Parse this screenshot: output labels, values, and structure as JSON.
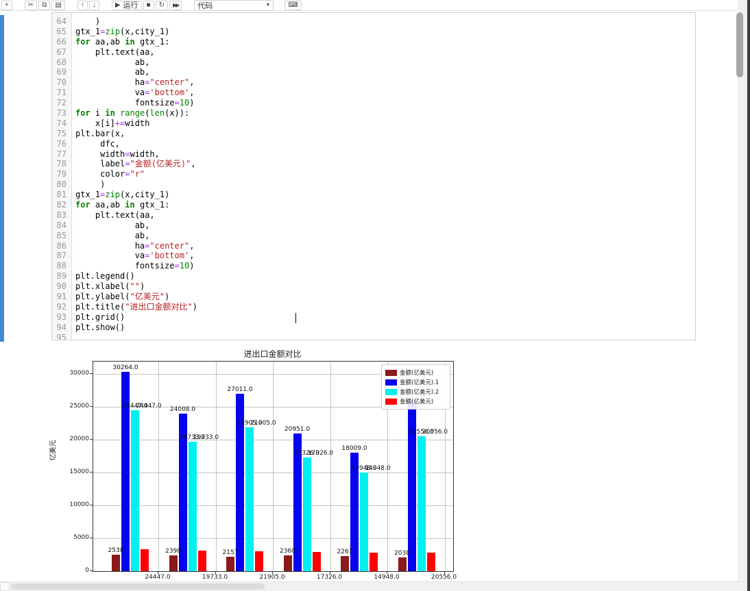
{
  "toolbar": {
    "groups": [
      [
        {
          "name": "insert-cell-below",
          "icon": "plus-icon",
          "glyph": "+"
        }
      ],
      [
        {
          "name": "cut-cell",
          "icon": "scissors-icon",
          "glyph": "✂"
        },
        {
          "name": "copy-cell",
          "icon": "copy-icon",
          "glyph": "⧉"
        },
        {
          "name": "paste-cell",
          "icon": "paste-icon",
          "glyph": "▤"
        }
      ],
      [
        {
          "name": "move-cell-up",
          "icon": "arrow-up-icon",
          "glyph": "↑"
        },
        {
          "name": "move-cell-down",
          "icon": "arrow-down-icon",
          "glyph": "↓"
        }
      ],
      [
        {
          "name": "run-cell",
          "icon": "play-icon",
          "glyph": "▶",
          "label": "运行"
        },
        {
          "name": "interrupt-kernel",
          "icon": "stop-icon",
          "glyph": "■"
        },
        {
          "name": "restart-kernel",
          "icon": "restart-icon",
          "glyph": "↻"
        },
        {
          "name": "restart-run-all",
          "icon": "fast-forward-icon",
          "glyph": "▶▶"
        }
      ]
    ],
    "cell_type": "代码",
    "dropdown_arrow": "▼",
    "keyboard_glyph": "⌨"
  },
  "code_cell": {
    "lines": [
      {
        "n": 64,
        "t": [
          [
            "pl",
            "    )"
          ]
        ]
      },
      {
        "n": 65,
        "t": [
          [
            "pl",
            "gtx_1"
          ],
          [
            "op",
            "="
          ],
          [
            "bi",
            "zip"
          ],
          [
            "pl",
            "(x,city_1)"
          ]
        ]
      },
      {
        "n": 66,
        "t": [
          [
            "kw",
            "for"
          ],
          [
            "pl",
            " aa,ab "
          ],
          [
            "kw",
            "in"
          ],
          [
            "pl",
            " gtx_1:"
          ]
        ]
      },
      {
        "n": 67,
        "t": [
          [
            "pl",
            "    plt.text(aa,"
          ]
        ]
      },
      {
        "n": 68,
        "t": [
          [
            "pl",
            "            ab,"
          ]
        ]
      },
      {
        "n": 69,
        "t": [
          [
            "pl",
            "            ab,"
          ]
        ]
      },
      {
        "n": 70,
        "t": [
          [
            "pl",
            "            ha"
          ],
          [
            "op",
            "="
          ],
          [
            "st",
            "\"center\""
          ],
          [
            "pl",
            ","
          ]
        ]
      },
      {
        "n": 71,
        "t": [
          [
            "pl",
            "            va"
          ],
          [
            "op",
            "="
          ],
          [
            "st",
            "'bottom'"
          ],
          [
            "pl",
            ","
          ]
        ]
      },
      {
        "n": 72,
        "t": [
          [
            "pl",
            "            fontsize"
          ],
          [
            "op",
            "="
          ],
          [
            "nu",
            "10"
          ],
          [
            "pl",
            ")"
          ]
        ]
      },
      {
        "n": 73,
        "t": [
          [
            "kw",
            "for"
          ],
          [
            "pl",
            " i "
          ],
          [
            "kw",
            "in"
          ],
          [
            "pl",
            " "
          ],
          [
            "bi",
            "range"
          ],
          [
            "pl",
            "("
          ],
          [
            "bi",
            "len"
          ],
          [
            "pl",
            "(x)):"
          ]
        ]
      },
      {
        "n": 74,
        "t": [
          [
            "pl",
            "    x[i]"
          ],
          [
            "op",
            "+="
          ],
          [
            "pl",
            "width"
          ]
        ]
      },
      {
        "n": 75,
        "t": [
          [
            "pl",
            "plt.bar(x,"
          ]
        ]
      },
      {
        "n": 76,
        "t": [
          [
            "pl",
            "     dfc,"
          ]
        ]
      },
      {
        "n": 77,
        "t": [
          [
            "pl",
            "     width"
          ],
          [
            "op",
            "="
          ],
          [
            "pl",
            "width,"
          ]
        ]
      },
      {
        "n": 78,
        "t": [
          [
            "pl",
            "     label"
          ],
          [
            "op",
            "="
          ],
          [
            "st",
            "\"金额(亿美元)\""
          ],
          [
            "pl",
            ","
          ]
        ]
      },
      {
        "n": 79,
        "t": [
          [
            "pl",
            "     color"
          ],
          [
            "op",
            "="
          ],
          [
            "st",
            "\"r\""
          ]
        ]
      },
      {
        "n": 80,
        "t": [
          [
            "pl",
            "     )"
          ]
        ]
      },
      {
        "n": 81,
        "t": [
          [
            "pl",
            "gtx_1"
          ],
          [
            "op",
            "="
          ],
          [
            "bi",
            "zip"
          ],
          [
            "pl",
            "(x,city_1)"
          ]
        ]
      },
      {
        "n": 82,
        "t": [
          [
            "kw",
            "for"
          ],
          [
            "pl",
            " aa,ab "
          ],
          [
            "kw",
            "in"
          ],
          [
            "pl",
            " gtx_1:"
          ]
        ]
      },
      {
        "n": 83,
        "t": [
          [
            "pl",
            "    plt.text(aa,"
          ]
        ]
      },
      {
        "n": 84,
        "t": [
          [
            "pl",
            "            ab,"
          ]
        ]
      },
      {
        "n": 85,
        "t": [
          [
            "pl",
            "            ab,"
          ]
        ]
      },
      {
        "n": 86,
        "t": [
          [
            "pl",
            "            ha"
          ],
          [
            "op",
            "="
          ],
          [
            "st",
            "\"center\""
          ],
          [
            "pl",
            ","
          ]
        ]
      },
      {
        "n": 87,
        "t": [
          [
            "pl",
            "            va"
          ],
          [
            "op",
            "="
          ],
          [
            "st",
            "'bottom'"
          ],
          [
            "pl",
            ","
          ]
        ]
      },
      {
        "n": 88,
        "t": [
          [
            "pl",
            "            fontsize"
          ],
          [
            "op",
            "="
          ],
          [
            "nu",
            "10"
          ],
          [
            "pl",
            ")"
          ]
        ]
      },
      {
        "n": 89,
        "t": [
          [
            "pl",
            "plt.legend()"
          ]
        ]
      },
      {
        "n": 90,
        "t": [
          [
            "pl",
            "plt.xlabel("
          ],
          [
            "st",
            "\"\""
          ],
          [
            "pl",
            ")"
          ]
        ]
      },
      {
        "n": 91,
        "t": [
          [
            "pl",
            "plt.ylabel("
          ],
          [
            "st",
            "\"亿美元\""
          ],
          [
            "pl",
            ")"
          ]
        ]
      },
      {
        "n": 92,
        "t": [
          [
            "pl",
            "plt.title("
          ],
          [
            "st",
            "\"进出口金额对比\""
          ],
          [
            "pl",
            ")"
          ]
        ]
      },
      {
        "n": 93,
        "t": [
          [
            "pl",
            "plt.grid()"
          ]
        ]
      },
      {
        "n": 94,
        "t": [
          [
            "pl",
            "plt.show()"
          ]
        ]
      },
      {
        "n": 95,
        "t": []
      }
    ]
  },
  "chart_data": {
    "type": "bar",
    "title": "进出口金额对比",
    "xlabel": "",
    "ylabel": "亿美元",
    "ylim": [
      0,
      31875
    ],
    "yticks": [
      0,
      5000,
      10000,
      15000,
      20000,
      25000,
      30000
    ],
    "grid": true,
    "legend_position": "upper right",
    "categories": [
      "24447.0",
      "19733.0",
      "21905.0",
      "17326.0",
      "14948.0",
      "20556.0"
    ],
    "series": [
      {
        "name": "金额(亿美元)",
        "color": "#8B1A1A",
        "values": [
          2538,
          2390,
          2157,
          2360,
          2261,
          2038
        ],
        "labels": [
          "2538",
          "2390",
          "2157",
          "2360",
          "2261",
          "2038"
        ],
        "label_mode": "single"
      },
      {
        "name": "金额(亿美元).1",
        "color": "#0404EE",
        "values": [
          30264,
          24008,
          27011,
          20951,
          18009,
          25963
        ],
        "labels": [
          "30264.0",
          "24008.0",
          "27011.0",
          "20951.0",
          "18009.0",
          "25963.0"
        ],
        "label_mode": "single"
      },
      {
        "name": "金额(亿美元).2",
        "color": "#00EFEF",
        "values": [
          24447,
          19733,
          21905,
          17326,
          14948,
          20556
        ],
        "labels": [
          "24447.0",
          "19733.0",
          "21905.0",
          "17326.0",
          "14948.0",
          "20556.0"
        ],
        "label_mode": "double"
      },
      {
        "name": "金额(亿美元)",
        "color": "#FF0000",
        "values": [
          3300,
          3100,
          3000,
          2950,
          2850,
          2800
        ],
        "labels": [],
        "label_mode": "none"
      }
    ]
  }
}
